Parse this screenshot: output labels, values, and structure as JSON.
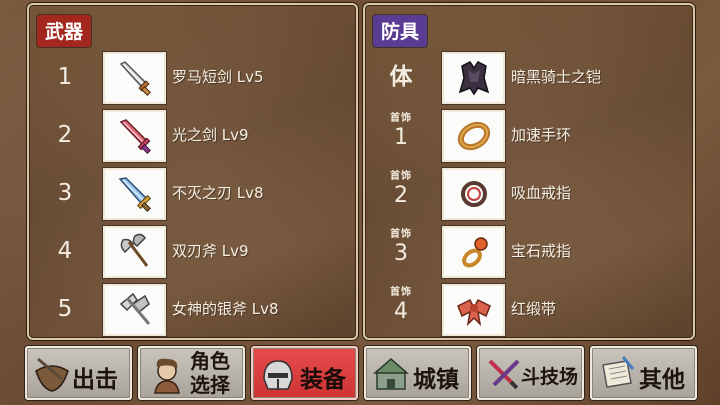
{
  "weapons": {
    "title": "武器",
    "items": [
      {
        "slot": "1",
        "name": "罗马短剑 Lv5",
        "icon": "short-sword-icon"
      },
      {
        "slot": "2",
        "name": "光之剑 Lv9",
        "icon": "light-sword-icon"
      },
      {
        "slot": "3",
        "name": "不灭之刃 Lv8",
        "icon": "undying-blade-icon"
      },
      {
        "slot": "4",
        "name": "双刃斧 Lv9",
        "icon": "double-axe-icon"
      },
      {
        "slot": "5",
        "name": "女神的银斧 Lv8",
        "icon": "silver-axe-icon"
      }
    ]
  },
  "armor": {
    "title": "防具",
    "items": [
      {
        "slot_label": "体",
        "name": "暗黑骑士之铠",
        "icon": "dark-armor-icon"
      },
      {
        "slot_small": "首饰",
        "slot": "1",
        "name": "加速手环",
        "icon": "bracelet-icon"
      },
      {
        "slot_small": "首饰",
        "slot": "2",
        "name": "吸血戒指",
        "icon": "ring-icon"
      },
      {
        "slot_small": "首饰",
        "slot": "3",
        "name": "宝石戒指",
        "icon": "gem-ring-icon"
      },
      {
        "slot_small": "首饰",
        "slot": "4",
        "name": "红缎带",
        "icon": "red-ribbon-icon"
      }
    ]
  },
  "nav": [
    {
      "label": "出击",
      "icon": "sortie-icon"
    },
    {
      "label_line1": "角色",
      "label_line2": "选择",
      "icon": "character-icon"
    },
    {
      "label": "装备",
      "icon": "helmet-icon",
      "active": true
    },
    {
      "label": "城镇",
      "icon": "town-icon"
    },
    {
      "label": "斗技场",
      "icon": "arena-sword-icon"
    },
    {
      "label": "其他",
      "icon": "scroll-icon"
    }
  ],
  "colors": {
    "weapons_title_bg": "#a3271f",
    "armor_title_bg": "#5a3c95",
    "nav_active_bg": "#cf3434"
  }
}
